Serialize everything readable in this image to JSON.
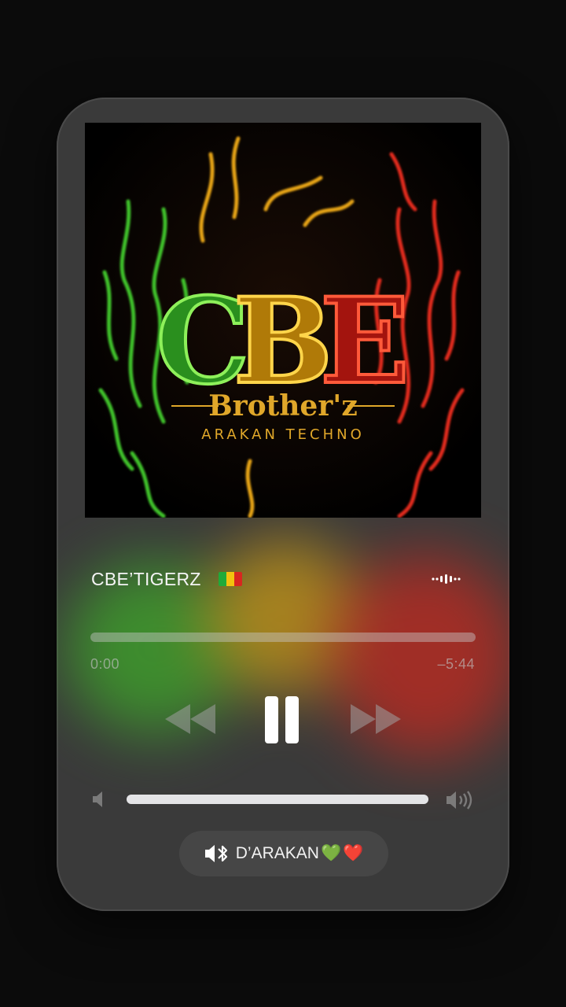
{
  "now_playing": {
    "track_title": "CBE’TIGERZ",
    "flag_icon": "flag-icon",
    "flag_colors": [
      "#1faa3a",
      "#f2c20f",
      "#d8261f"
    ],
    "artwork": {
      "monogram": "CBE",
      "subtitle": "Brother'z",
      "tagline": "ARAKAN TECHNO",
      "colors": {
        "c": "#38c22a",
        "b": "#f1b10d",
        "e": "#e2201b"
      }
    }
  },
  "progress": {
    "elapsed": "0:00",
    "remaining": "–5:44",
    "fraction": 0.0
  },
  "controls": {
    "rewind_icon": "rewind-icon",
    "pause_icon": "pause-icon",
    "fast_forward_icon": "fast-forward-icon"
  },
  "volume": {
    "level": 1.0,
    "low_icon": "speaker-low-icon",
    "high_icon": "speaker-high-icon"
  },
  "output_device": {
    "label": "D’ARAKAN",
    "speaker_icon": "bluetooth-speaker-icon",
    "emoji": [
      "💚",
      "❤️"
    ]
  },
  "theme": {
    "card_bg": "#3a3a3a",
    "text": "#f4f4f4",
    "muted": "#9a9a9a"
  }
}
